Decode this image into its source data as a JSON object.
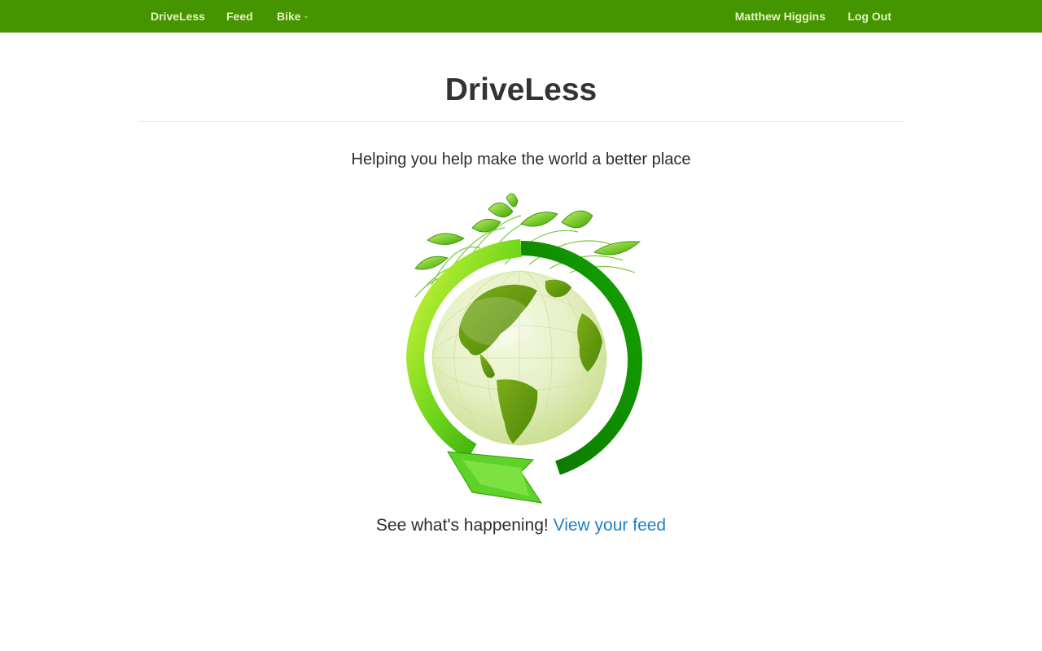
{
  "nav": {
    "brand": "DriveLess",
    "feed": "Feed",
    "bike": "Bike",
    "user": "Matthew Higgins",
    "logout": "Log Out"
  },
  "hero": {
    "title": "DriveLess",
    "tagline": "Helping you help make the world a better place",
    "cta_text": "See what's happening!",
    "cta_link": "View your feed"
  },
  "icons": {
    "bike_dropdown": "caret-down-icon",
    "hero_image": "green-globe-icon"
  },
  "colors": {
    "navbar": "#449500",
    "nav_text": "#e6f3c2",
    "link": "#1f80c8",
    "globe_green": "#4caf00"
  }
}
